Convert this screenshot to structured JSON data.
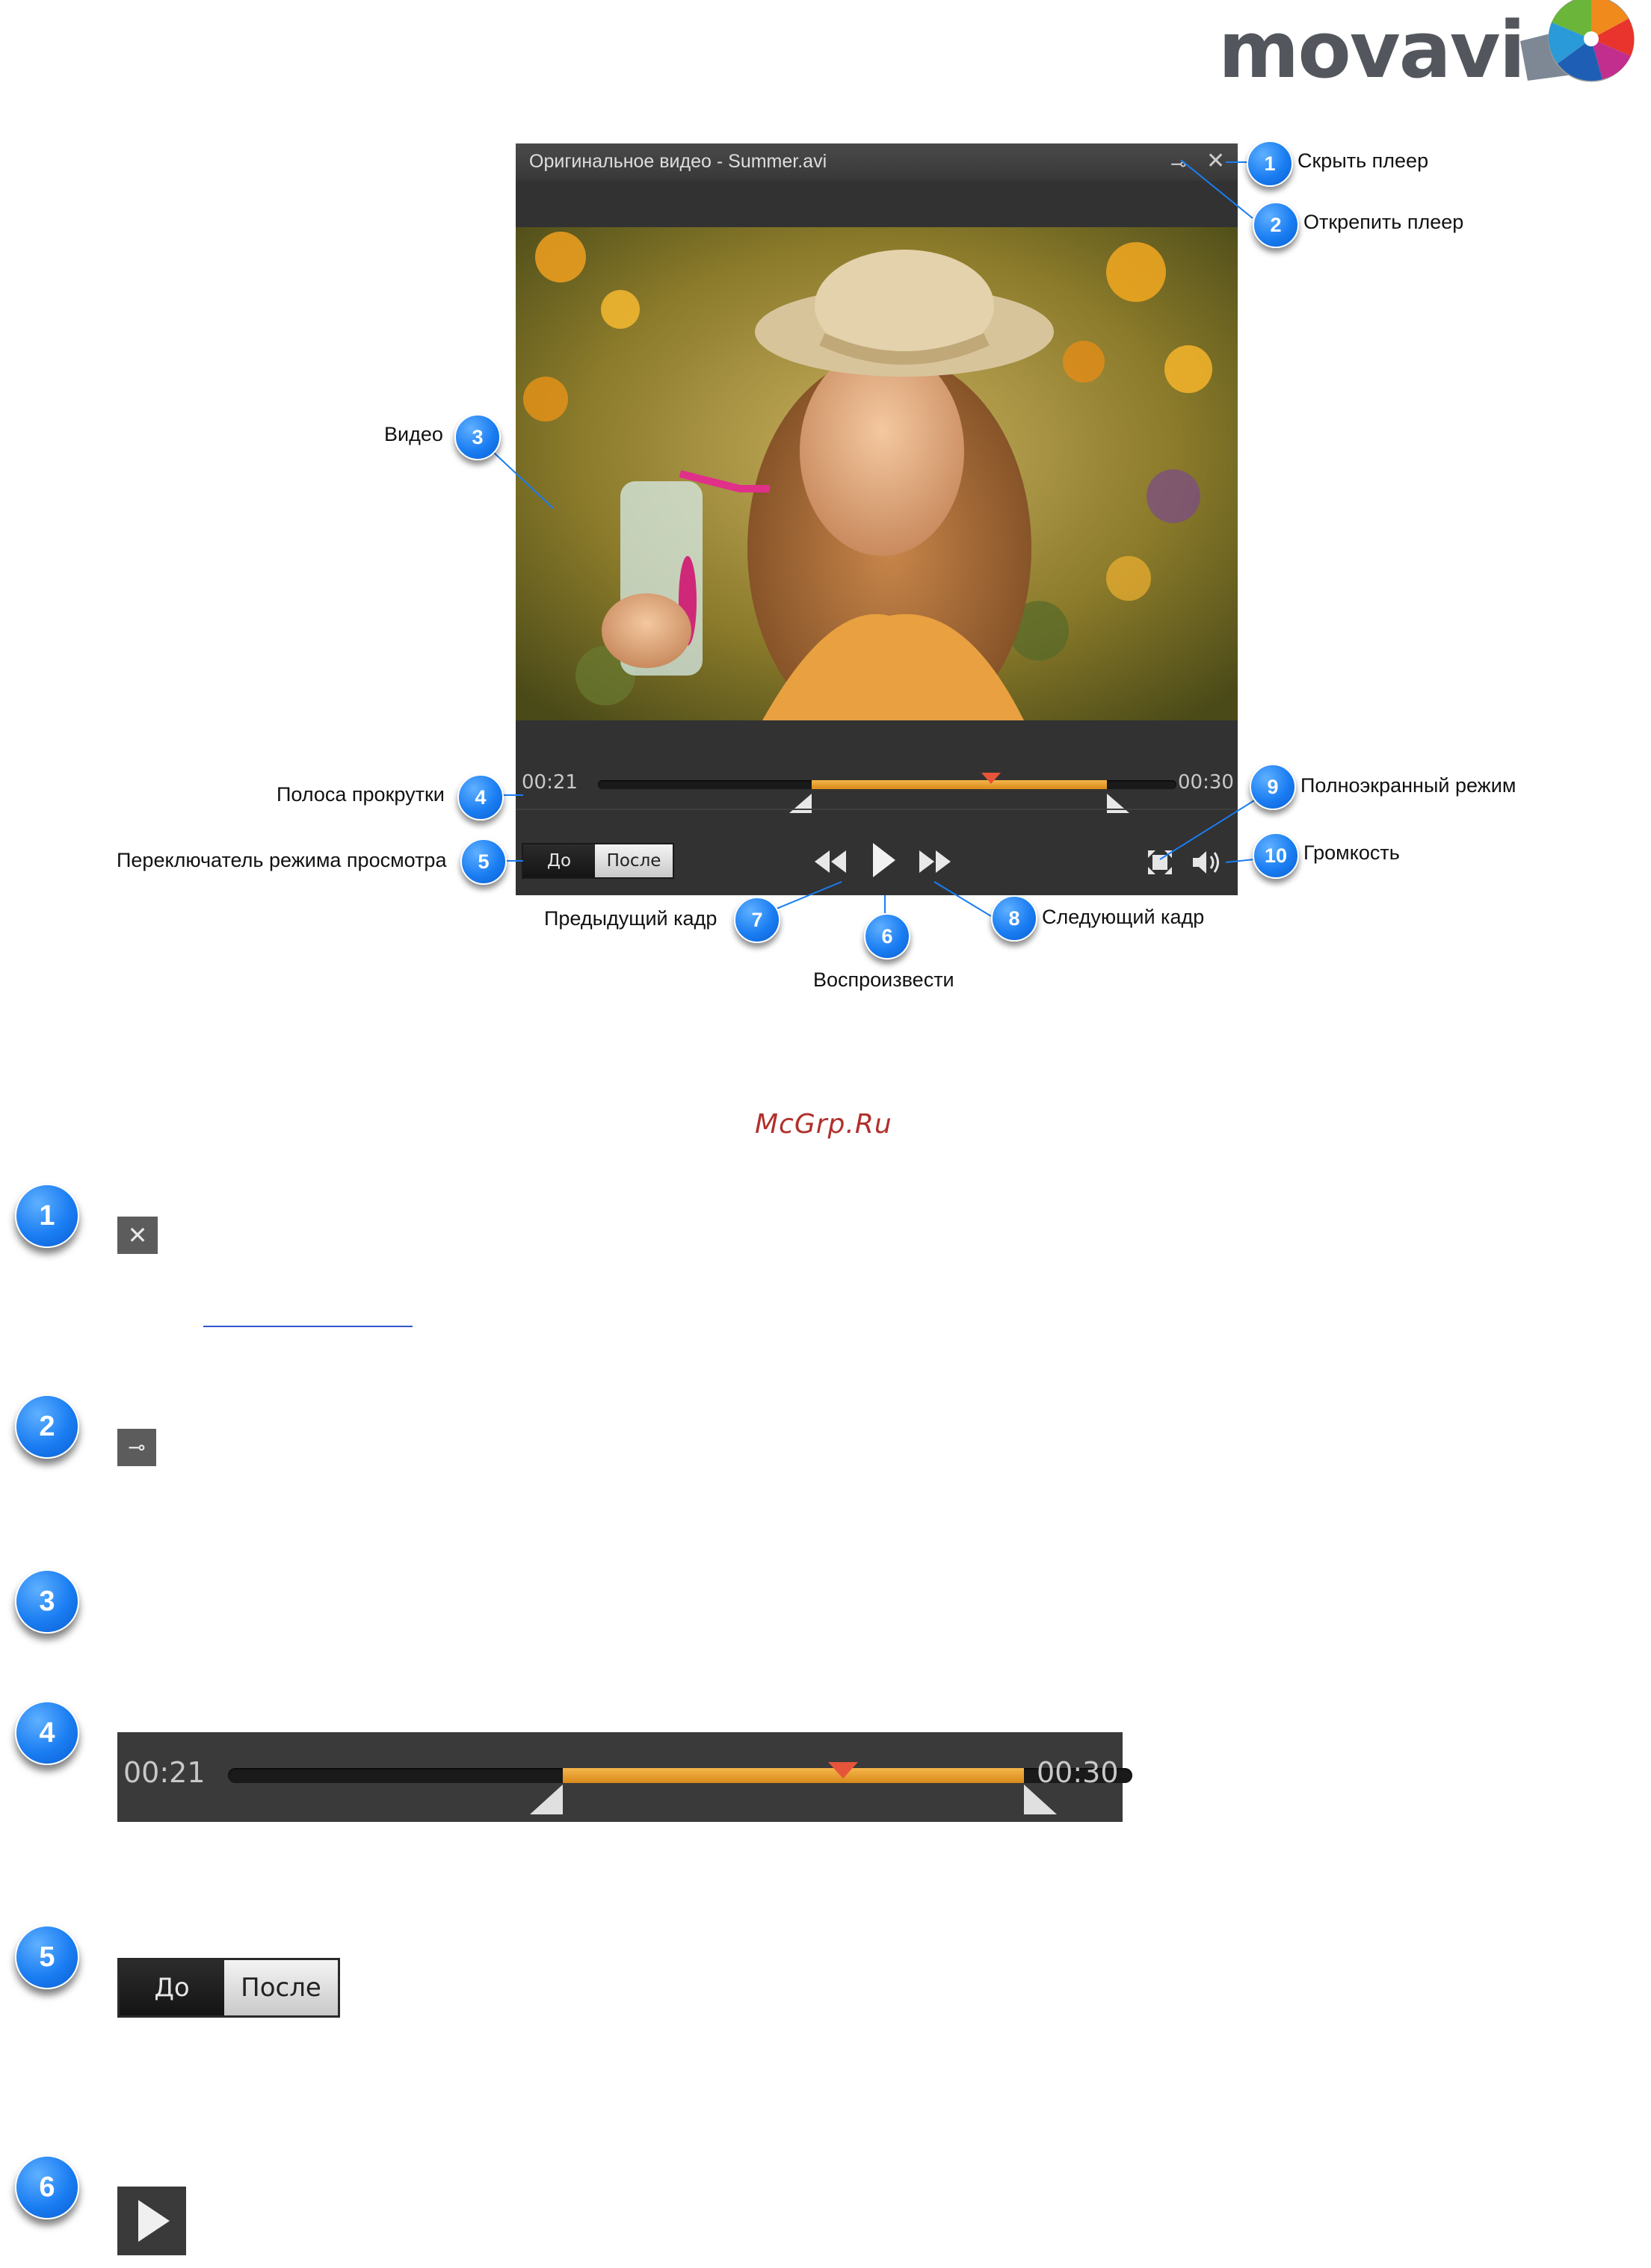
{
  "logo": {
    "text": "movavi"
  },
  "player": {
    "title": "Оригинальное видео - Summer.avi",
    "current_time": "00:21",
    "end_time": "00:30",
    "selection_fraction": [
      0.37,
      0.88
    ],
    "playhead_fraction": 0.68,
    "toggle": {
      "before": "До",
      "after": "После"
    }
  },
  "callouts": [
    {
      "number": "1",
      "label": "Скрыть плеер"
    },
    {
      "number": "2",
      "label": "Открепить плеер"
    },
    {
      "number": "3",
      "label": "Видео"
    },
    {
      "number": "4",
      "label": "Полоса прокрутки"
    },
    {
      "number": "5",
      "label": "Переключатель режима просмотра"
    },
    {
      "number": "6",
      "label": "Воспроизвести"
    },
    {
      "number": "7",
      "label": "Предыдущий кадр"
    },
    {
      "number": "8",
      "label": "Следующий кадр"
    },
    {
      "number": "9",
      "label": "Полноэкранный режим"
    },
    {
      "number": "10",
      "label": "Громкость"
    }
  ],
  "watermark": "McGrp.Ru",
  "details": {
    "n1": "1",
    "n2": "2",
    "n3": "3",
    "n4": "4",
    "n5": "5",
    "n6": "6",
    "seek_current": "00:21",
    "seek_end": "00:30",
    "toggle_before": "До",
    "toggle_after": "После"
  },
  "colors": {
    "bubble": "#1a7df2",
    "selection": "#e8982a",
    "watermark": "#b0302c"
  }
}
